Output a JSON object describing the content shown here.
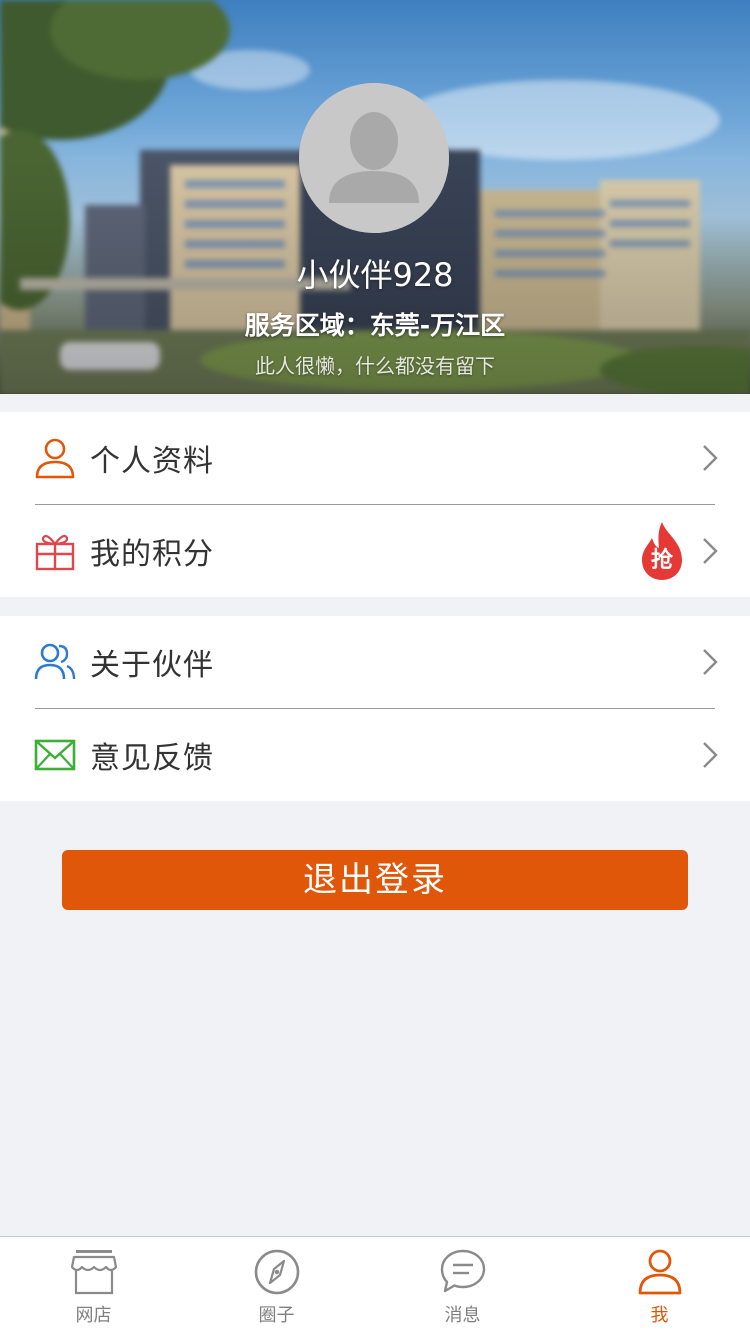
{
  "profile": {
    "username": "小伙伴928",
    "service_area": "服务区域：东莞-万江区",
    "bio": "此人很懒，什么都没有留下"
  },
  "menu_group_1": [
    {
      "label": "个人资料",
      "icon": "user-icon"
    },
    {
      "label": "我的积分",
      "icon": "gift-icon",
      "badge": "抢"
    }
  ],
  "menu_group_2": [
    {
      "label": "关于伙伴",
      "icon": "users-icon"
    },
    {
      "label": "意见反馈",
      "icon": "mail-icon"
    }
  ],
  "logout_label": "退出登录",
  "tabbar": [
    {
      "label": "网店",
      "icon": "store-icon",
      "active": false
    },
    {
      "label": "圈子",
      "icon": "compass-icon",
      "active": false
    },
    {
      "label": "消息",
      "icon": "chat-icon",
      "active": false
    },
    {
      "label": "我",
      "icon": "user-icon",
      "active": true
    }
  ],
  "colors": {
    "accent": "#e15709",
    "badge_red": "#e53935",
    "users_icon_blue": "#2d7bd0",
    "mail_icon_green": "#3cb035",
    "gift_icon_red": "#e0474c",
    "text_primary": "#333333",
    "tab_inactive": "#808080",
    "background": "#f1f2f6"
  }
}
